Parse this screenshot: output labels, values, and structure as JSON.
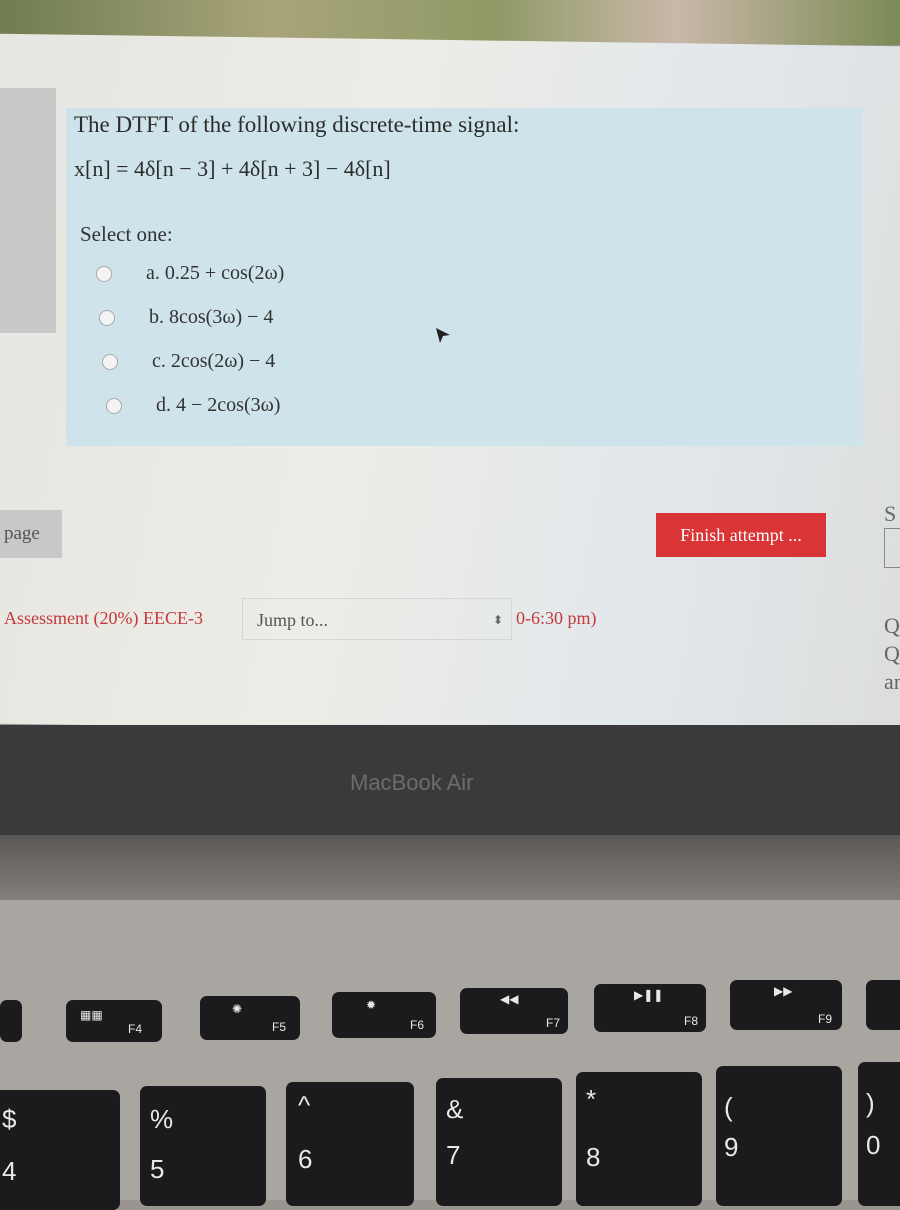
{
  "question": {
    "text": "The DTFT of the following discrete-time signal:",
    "formula": "x[n] = 4δ[n − 3] + 4δ[n + 3] − 4δ[n]",
    "select_label": "Select one:",
    "options": [
      {
        "label": "a. 0.25 + cos(2ω)"
      },
      {
        "label": "b. 8cos(3ω) − 4"
      },
      {
        "label": "c. 2cos(2ω) − 4"
      },
      {
        "label": "d. 4 − 2cos(3ω)"
      }
    ]
  },
  "nav": {
    "prev_page": "page",
    "finish_attempt": "Finish attempt ...",
    "breadcrumb": "Assessment (20%) EECE-3",
    "jump_to": "Jump to...",
    "time_suffix": "0-6:30 pm)",
    "right_column": [
      "S",
      "Q",
      "Q",
      "an"
    ]
  },
  "laptop": {
    "brand": "MacBook Air",
    "fkeys": [
      "F4",
      "F5",
      "F6",
      "F7",
      "F8",
      "F9"
    ],
    "numkeys": [
      {
        "top": "$",
        "bottom": "4"
      },
      {
        "top": "%",
        "bottom": "5"
      },
      {
        "top": "^",
        "bottom": "6"
      },
      {
        "top": "&",
        "bottom": "7"
      },
      {
        "top": "*",
        "bottom": "8"
      },
      {
        "top": "(",
        "bottom": "9"
      },
      {
        "top": ")",
        "bottom": "0"
      }
    ]
  },
  "colors": {
    "finish": "#d93436",
    "question_bg": "#cfe3ea",
    "breadcrumb": "#c23a3a"
  }
}
